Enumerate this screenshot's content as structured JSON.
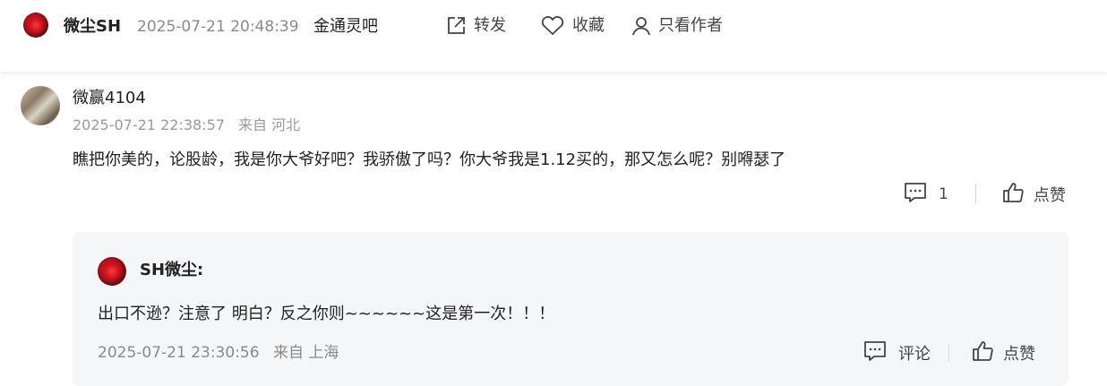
{
  "post_header": {
    "author": "微尘SH",
    "timestamp": "2025-07-21 20:48:39",
    "bar_name": "金通灵吧",
    "actions": {
      "forward": "转发",
      "favorite": "收藏",
      "author_only": "只看作者"
    }
  },
  "comment": {
    "username": "微赢4104",
    "timestamp": "2025-07-21 22:38:57",
    "location": "来自 河北",
    "text": "瞧把你美的，论股龄，我是你大爷好吧？我骄傲了吗？你大爷我是1.12买的，那又怎么呢？别嘚瑟了",
    "reply_count": "1",
    "like_label": "点赞"
  },
  "reply": {
    "username": "SH微尘:",
    "text": "出口不逊？注意了 明白？反之你则~~~~~~这是第一次！！！",
    "timestamp": "2025-07-21 23:30:56",
    "location": "来自 上海",
    "comment_label": "评论",
    "like_label": "点赞"
  },
  "colors": {
    "accent_text": "#222222",
    "muted_text": "#8a8a8a",
    "reply_bg": "#f5f6f8"
  }
}
